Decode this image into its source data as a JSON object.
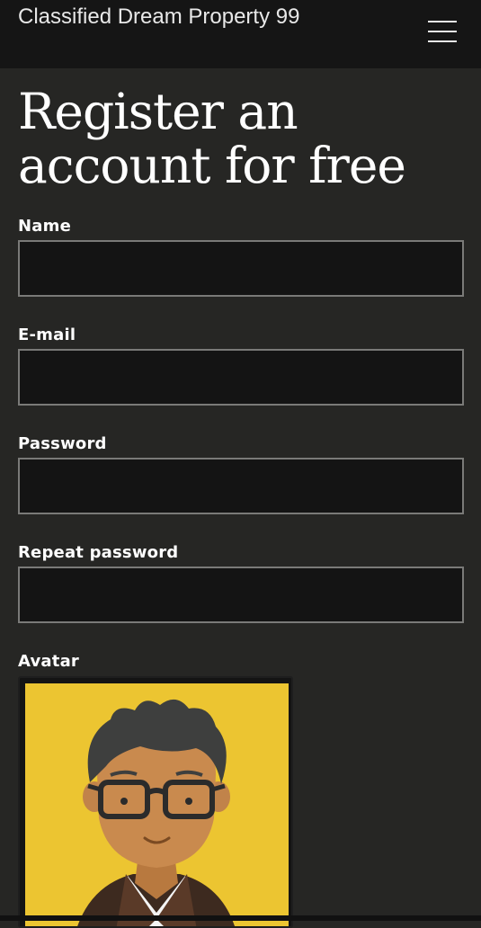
{
  "header": {
    "site_title": "Classified Dream Property 99",
    "menu_icon": "hamburger-menu-icon"
  },
  "main": {
    "title": "Register an account for free",
    "fields": [
      {
        "label": "Name",
        "value": "",
        "type": "text"
      },
      {
        "label": "E-mail",
        "value": "",
        "type": "email"
      },
      {
        "label": "Password",
        "value": "",
        "type": "password"
      },
      {
        "label": "Repeat password",
        "value": "",
        "type": "password"
      }
    ],
    "avatar": {
      "label": "Avatar",
      "image": "cartoon-man-with-glasses-avatar"
    }
  },
  "colors": {
    "header_bg": "#151515",
    "page_bg": "#262624",
    "input_bg": "#141414",
    "input_border": "#7a7a78",
    "avatar_bg": "#ecc531",
    "text": "#ffffff"
  }
}
